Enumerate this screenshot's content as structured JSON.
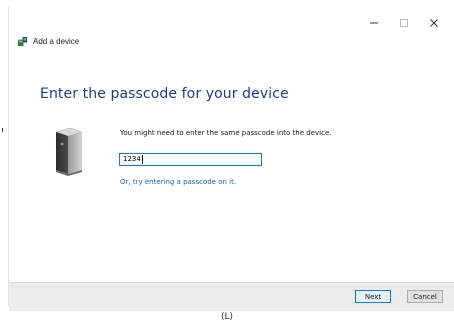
{
  "window": {
    "title": "Add a device",
    "controls": {
      "minimize_icon": "minimize-icon",
      "maximize_icon": "maximize-icon",
      "close_icon": "close-icon"
    }
  },
  "main": {
    "heading": "Enter the passcode for your device",
    "instruction": "You might need to enter the same passcode into the device.",
    "passcode_value": "1234",
    "alternate_link": "Or, try entering a passcode on it."
  },
  "footer": {
    "next_label": "Next",
    "cancel_label": "Cancel"
  },
  "caption": "(L)",
  "colors": {
    "heading": "#1e3d8f",
    "link": "#1766b5",
    "input_border": "#1979ca",
    "footer_bg": "#ececec"
  }
}
